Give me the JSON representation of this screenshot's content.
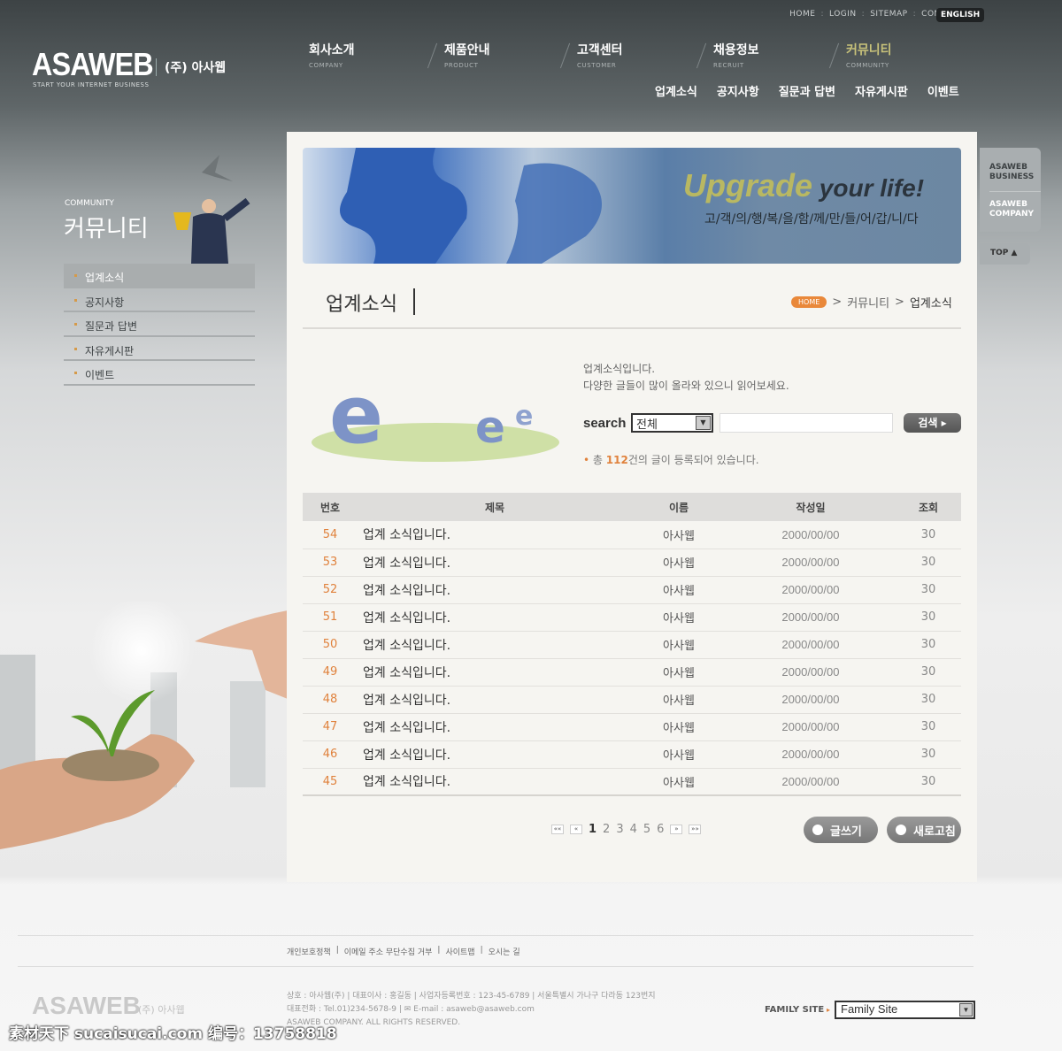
{
  "top_links": [
    "HOME",
    "LOGIN",
    "SITEMAP",
    "CONTACT US"
  ],
  "english": "ENGLISH",
  "logo": {
    "name": "ASAWEB",
    "korean": "(주) 아사웹",
    "tagline": "START YOUR INTERNET BUSINESS"
  },
  "gnav": [
    {
      "ko": "회사소개",
      "en": "COMPANY"
    },
    {
      "ko": "제품안내",
      "en": "PRODUCT"
    },
    {
      "ko": "고객센터",
      "en": "CUSTOMER"
    },
    {
      "ko": "채용정보",
      "en": "RECRUIT"
    },
    {
      "ko": "커뮤니티",
      "en": "COMMUNITY"
    }
  ],
  "subnav": [
    "업계소식",
    "공지사항",
    "질문과 답변",
    "자유게시판",
    "이벤트"
  ],
  "sidebar": {
    "en": "COMMUNITY",
    "ko": "커뮤니티",
    "items": [
      "업계소식",
      "공지사항",
      "질문과 답변",
      "자유게시판",
      "이벤트"
    ]
  },
  "banner": {
    "title_a": "Upgrade",
    "title_b": " your life!",
    "slogan": "고/객/의/행/복/을/함/께/만/들/어/갑/니/다"
  },
  "page": {
    "title": "업계소식",
    "breadcrumb": {
      "home": "HOME",
      "section": "커뮤니티",
      "current": "업계소식"
    }
  },
  "intro": {
    "line1": "업계소식입니다.",
    "line2": "다양한 글들이 많이 올라와 있으니 읽어보세요."
  },
  "search": {
    "label": "search",
    "select_value": "전체",
    "query": "",
    "button": "검색 ▸"
  },
  "count": {
    "prefix": "총 ",
    "num": "112",
    "suffix": "건의 글이 등록되어 있습니다."
  },
  "table": {
    "headers": [
      "번호",
      "제목",
      "이름",
      "작성일",
      "조회"
    ],
    "rows": [
      [
        "54",
        "업계 소식입니다.",
        "아사웹",
        "2000/00/00",
        "30"
      ],
      [
        "53",
        "업계 소식입니다.",
        "아사웹",
        "2000/00/00",
        "30"
      ],
      [
        "52",
        "업계 소식입니다.",
        "아사웹",
        "2000/00/00",
        "30"
      ],
      [
        "51",
        "업계 소식입니다.",
        "아사웹",
        "2000/00/00",
        "30"
      ],
      [
        "50",
        "업계 소식입니다.",
        "아사웹",
        "2000/00/00",
        "30"
      ],
      [
        "49",
        "업계 소식입니다.",
        "아사웹",
        "2000/00/00",
        "30"
      ],
      [
        "48",
        "업계 소식입니다.",
        "아사웹",
        "2000/00/00",
        "30"
      ],
      [
        "47",
        "업계 소식입니다.",
        "아사웹",
        "2000/00/00",
        "30"
      ],
      [
        "46",
        "업계 소식입니다.",
        "아사웹",
        "2000/00/00",
        "30"
      ],
      [
        "45",
        "업계 소식입니다.",
        "아사웹",
        "2000/00/00",
        "30"
      ]
    ]
  },
  "pagination": {
    "first": "««",
    "prev": "«",
    "pages": [
      "1",
      "2",
      "3",
      "4",
      "5",
      "6"
    ],
    "current": "1",
    "next": "»",
    "last": "»»"
  },
  "buttons": {
    "write": "글쓰기",
    "refresh": "새로고침"
  },
  "right_tab": {
    "a": "ASAWEB BUSINESS",
    "b": "ASAWEB COMPANY",
    "top": "TOP ▲"
  },
  "footer": {
    "links": [
      "개인보호정책",
      "이메일 주소 무단수집 거부",
      "사이트맵",
      "오시는 길"
    ],
    "addr1": "상호 : 아사웹(주)  |  대표이사 : 홍길동  |  사업자등록번호 : 123-45-6789  |  서울특별시 가나구 다라동 123번지",
    "addr2": "대표전화 : Tel.01)234-5678-9  |  ✉ E-mail : asaweb@asaweb.com",
    "copyright": "ASAWEB COMPANY. ALL RIGHTS RESERVED.",
    "logo": "ASAWEB",
    "logo_ko": "(주) 아사웹",
    "family_label": "FAMILY SITE",
    "family_value": "Family Site"
  },
  "watermark": "素材天下 sucaisucai.com  编号：13758818",
  "colors": {
    "accent": "#e0823d",
    "active_nav": "#c8c27a"
  }
}
